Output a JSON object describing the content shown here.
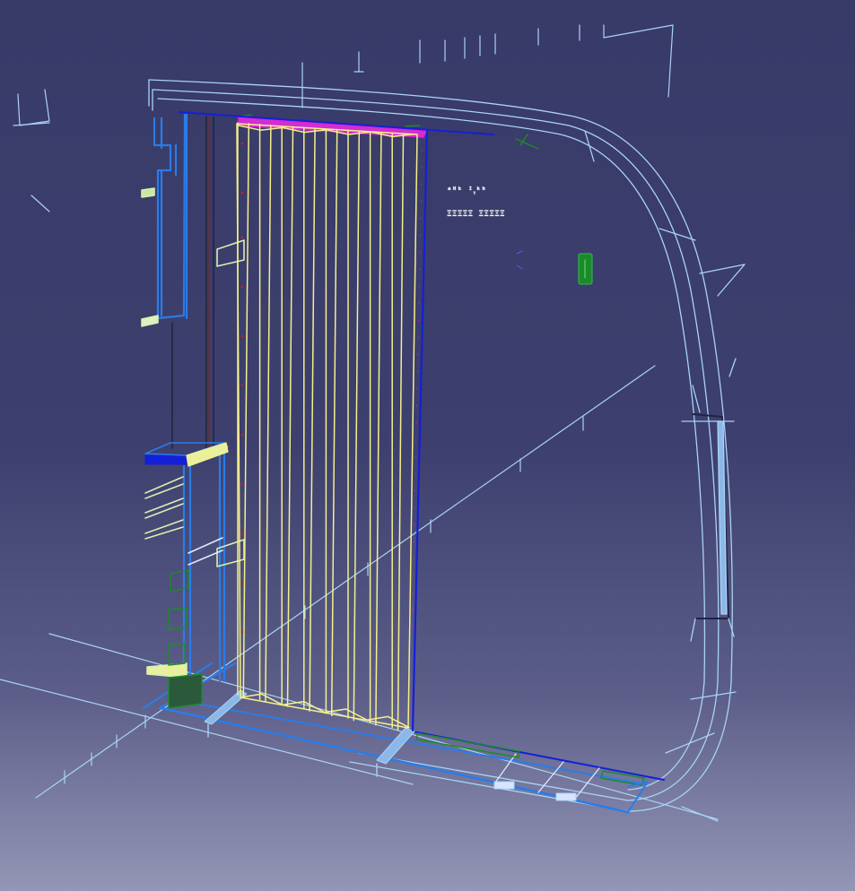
{
  "viewport": {
    "background_top": "#383a68",
    "background_bottom": "#9496b6"
  },
  "palette": {
    "hull_line": "#a9d3f5",
    "bulkhead": "#2a7ce8",
    "deep_blue": "#1420d8",
    "corrugation": "#f4f08a",
    "top_plate": "#e020d8",
    "bracket": "#d8f0b0",
    "green_part": "#1e8a2a"
  },
  "annotations": [
    {
      "id": "label-1",
      "text": "ᵃᴴᵏ ᴵᵧᵏʰ"
    },
    {
      "id": "label-2",
      "text": "ΞΞΞΞΞ ΞΞΞΞΞ"
    }
  ],
  "icons": [
    "compass-axis-icon",
    "green-marker-icon"
  ]
}
